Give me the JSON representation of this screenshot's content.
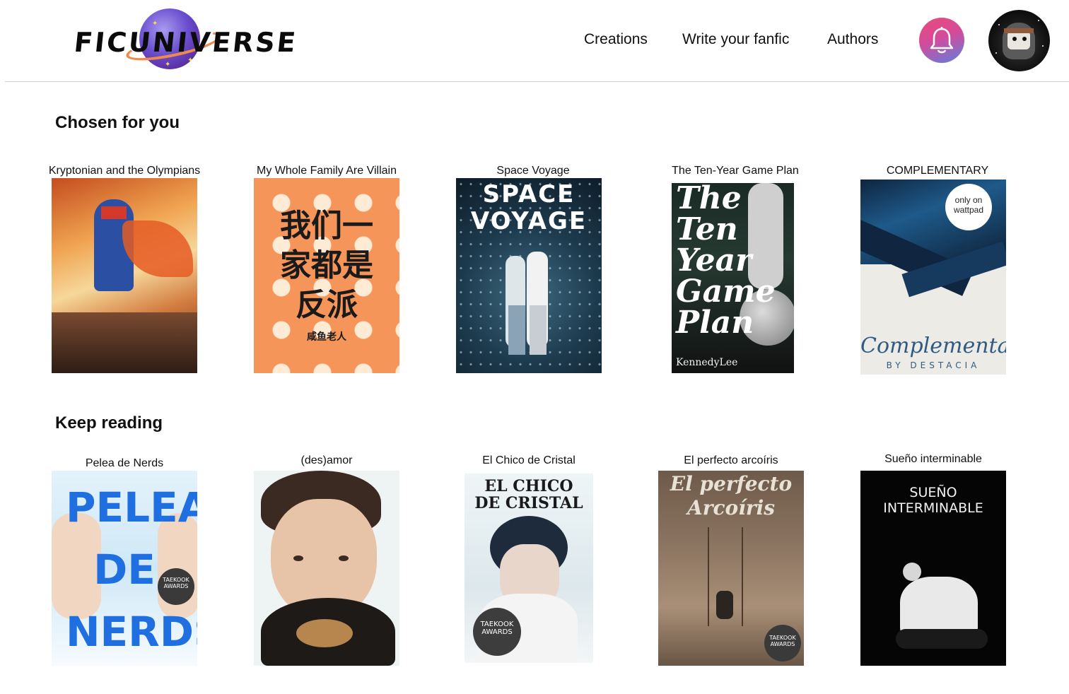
{
  "header": {
    "logo_text": "FICUNIVERSE",
    "nav": [
      "Creations",
      "Write your fanfic",
      "Authors"
    ],
    "colors": {
      "bell_gradient": [
        "#ec4a7a",
        "#5f7fe0"
      ]
    },
    "icons": {
      "notifications": "bell-icon",
      "profile": "avatar"
    }
  },
  "sections": {
    "chosen": {
      "title": "Chosen for you",
      "books": [
        {
          "title": "Kryptonian and the Olympians"
        },
        {
          "title": "My Whole Family Are Villain",
          "cover_text": "我们一家都是反派",
          "cover_author": "咸鱼老人"
        },
        {
          "title": "Space Voyage",
          "cover_text": "SPACE VOYAGE"
        },
        {
          "title": "The Ten-Year Game Plan",
          "cover_text": "The Ten Year Game Plan",
          "cover_author": "KennedyLee"
        },
        {
          "title": "COMPLEMENTARY",
          "cover_text": "Complementary",
          "cover_author": "BY DESTACIA",
          "badge": "only on wattpad"
        }
      ]
    },
    "keep": {
      "title": "Keep reading",
      "books": [
        {
          "title": "Pelea de Nerds",
          "cover_text": "PELEA DE NERDS",
          "badge": "TAEKOOK AWARDS"
        },
        {
          "title": "(des)amor"
        },
        {
          "title": "El Chico de Cristal",
          "cover_text": "EL CHICO DE CRISTAL",
          "badge": "TAEKOOK AWARDS"
        },
        {
          "title": "El perfecto arcoíris",
          "cover_text": "El perfecto Arcoíris",
          "badge": "TAEKOOK AWARDS"
        },
        {
          "title": "Sueño interminable",
          "cover_text": "SUEÑO INTERMINABLE"
        }
      ]
    }
  }
}
